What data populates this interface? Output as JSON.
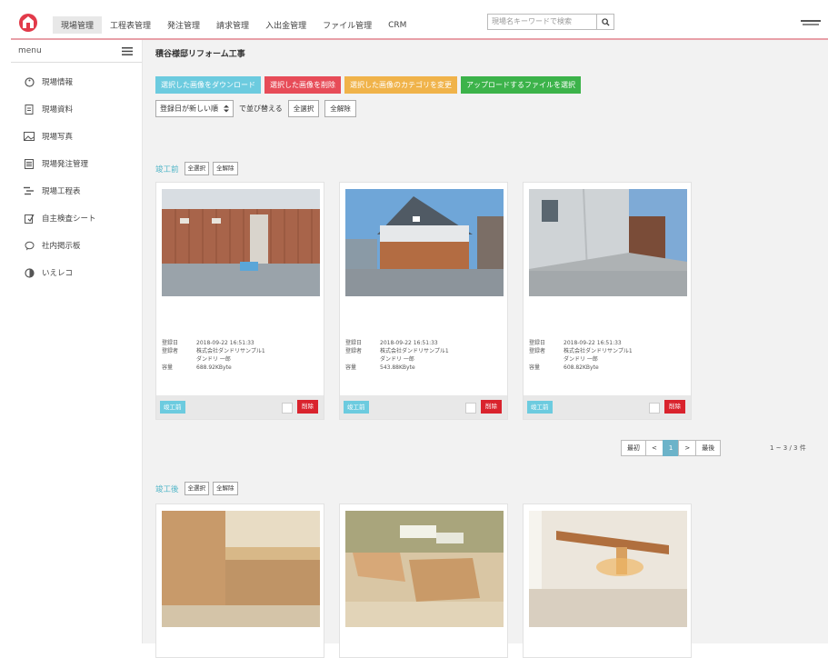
{
  "topbar": {
    "nav": [
      "現場管理",
      "工程表管理",
      "発注管理",
      "請求管理",
      "入出金管理",
      "ファイル管理",
      "CRM"
    ],
    "search_placeholder": "現場名キーワードで検索"
  },
  "sidebar": {
    "menu_label": "menu",
    "items": [
      {
        "label": "現場情報",
        "icon": "palette-icon"
      },
      {
        "label": "現場資料",
        "icon": "document-icon"
      },
      {
        "label": "現場写真",
        "icon": "image-icon"
      },
      {
        "label": "現場発注管理",
        "icon": "list-icon"
      },
      {
        "label": "現場工程表",
        "icon": "schedule-icon"
      },
      {
        "label": "自主検査シート",
        "icon": "check-edit-icon"
      },
      {
        "label": "社内掲示板",
        "icon": "chat-icon"
      },
      {
        "label": "いえレコ",
        "icon": "pie-icon"
      }
    ]
  },
  "main": {
    "title": "積谷様邸リフォーム工事",
    "actions": [
      {
        "label": "選択した画像をダウンロード",
        "color": "#6ccbdf"
      },
      {
        "label": "選択した画像を削除",
        "color": "#e74c58"
      },
      {
        "label": "選択した画像のカテゴリを変更",
        "color": "#f0b34a"
      },
      {
        "label": "アップロードするファイルを選択",
        "color": "#3cb34a"
      }
    ],
    "sort": {
      "select_value": "登録日が新しい順",
      "sort_label": "で並び替える",
      "select_all": "全選択",
      "deselect_all": "全解除"
    },
    "sections": [
      {
        "label": "竣工前",
        "select_all": "全選択",
        "deselect_all": "全解除",
        "cards": [
          {
            "meta": [
              [
                "登録日",
                "2018-09-22 16:51:33"
              ],
              [
                "登録者",
                "株式会社ダンドリサンプル1"
              ],
              [
                "",
                "ダンドリ 一郎"
              ],
              [
                "容量",
                "688.92KByte"
              ]
            ],
            "tag": "竣工前",
            "delete": "削除"
          },
          {
            "meta": [
              [
                "登録日",
                "2018-09-22 16:51:33"
              ],
              [
                "登録者",
                "株式会社ダンドリサンプル1"
              ],
              [
                "",
                "ダンドリ 一郎"
              ],
              [
                "容量",
                "543.88KByte"
              ]
            ],
            "tag": "竣工前",
            "delete": "削除"
          },
          {
            "meta": [
              [
                "登録日",
                "2018-09-22 16:51:33"
              ],
              [
                "登録者",
                "株式会社ダンドリサンプル1"
              ],
              [
                "",
                "ダンドリ 一郎"
              ],
              [
                "容量",
                "608.82KByte"
              ]
            ],
            "tag": "竣工前",
            "delete": "削除"
          }
        ],
        "pager": {
          "first": "最初",
          "prev": "<",
          "page": "1",
          "next": ">",
          "last": "最後",
          "count": "1 ~ 3 / 3 件"
        }
      },
      {
        "label": "竣工後",
        "select_all": "全選択",
        "deselect_all": "全解除"
      }
    ]
  }
}
